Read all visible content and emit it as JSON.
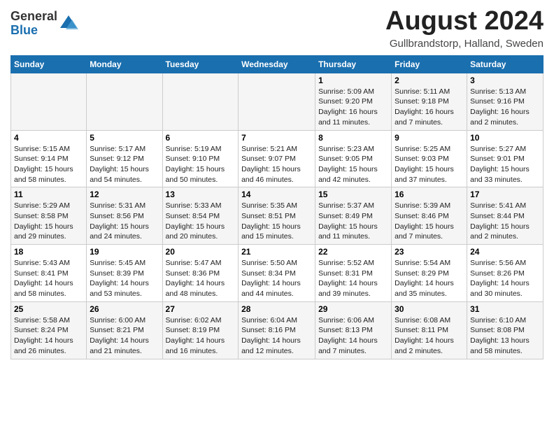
{
  "header": {
    "logo_general": "General",
    "logo_blue": "Blue",
    "month": "August 2024",
    "location": "Gullbrandstorp, Halland, Sweden"
  },
  "days_of_week": [
    "Sunday",
    "Monday",
    "Tuesday",
    "Wednesday",
    "Thursday",
    "Friday",
    "Saturday"
  ],
  "weeks": [
    [
      {
        "day": "",
        "info": ""
      },
      {
        "day": "",
        "info": ""
      },
      {
        "day": "",
        "info": ""
      },
      {
        "day": "",
        "info": ""
      },
      {
        "day": "1",
        "info": "Sunrise: 5:09 AM\nSunset: 9:20 PM\nDaylight: 16 hours\nand 11 minutes."
      },
      {
        "day": "2",
        "info": "Sunrise: 5:11 AM\nSunset: 9:18 PM\nDaylight: 16 hours\nand 7 minutes."
      },
      {
        "day": "3",
        "info": "Sunrise: 5:13 AM\nSunset: 9:16 PM\nDaylight: 16 hours\nand 2 minutes."
      }
    ],
    [
      {
        "day": "4",
        "info": "Sunrise: 5:15 AM\nSunset: 9:14 PM\nDaylight: 15 hours\nand 58 minutes."
      },
      {
        "day": "5",
        "info": "Sunrise: 5:17 AM\nSunset: 9:12 PM\nDaylight: 15 hours\nand 54 minutes."
      },
      {
        "day": "6",
        "info": "Sunrise: 5:19 AM\nSunset: 9:10 PM\nDaylight: 15 hours\nand 50 minutes."
      },
      {
        "day": "7",
        "info": "Sunrise: 5:21 AM\nSunset: 9:07 PM\nDaylight: 15 hours\nand 46 minutes."
      },
      {
        "day": "8",
        "info": "Sunrise: 5:23 AM\nSunset: 9:05 PM\nDaylight: 15 hours\nand 42 minutes."
      },
      {
        "day": "9",
        "info": "Sunrise: 5:25 AM\nSunset: 9:03 PM\nDaylight: 15 hours\nand 37 minutes."
      },
      {
        "day": "10",
        "info": "Sunrise: 5:27 AM\nSunset: 9:01 PM\nDaylight: 15 hours\nand 33 minutes."
      }
    ],
    [
      {
        "day": "11",
        "info": "Sunrise: 5:29 AM\nSunset: 8:58 PM\nDaylight: 15 hours\nand 29 minutes."
      },
      {
        "day": "12",
        "info": "Sunrise: 5:31 AM\nSunset: 8:56 PM\nDaylight: 15 hours\nand 24 minutes."
      },
      {
        "day": "13",
        "info": "Sunrise: 5:33 AM\nSunset: 8:54 PM\nDaylight: 15 hours\nand 20 minutes."
      },
      {
        "day": "14",
        "info": "Sunrise: 5:35 AM\nSunset: 8:51 PM\nDaylight: 15 hours\nand 15 minutes."
      },
      {
        "day": "15",
        "info": "Sunrise: 5:37 AM\nSunset: 8:49 PM\nDaylight: 15 hours\nand 11 minutes."
      },
      {
        "day": "16",
        "info": "Sunrise: 5:39 AM\nSunset: 8:46 PM\nDaylight: 15 hours\nand 7 minutes."
      },
      {
        "day": "17",
        "info": "Sunrise: 5:41 AM\nSunset: 8:44 PM\nDaylight: 15 hours\nand 2 minutes."
      }
    ],
    [
      {
        "day": "18",
        "info": "Sunrise: 5:43 AM\nSunset: 8:41 PM\nDaylight: 14 hours\nand 58 minutes."
      },
      {
        "day": "19",
        "info": "Sunrise: 5:45 AM\nSunset: 8:39 PM\nDaylight: 14 hours\nand 53 minutes."
      },
      {
        "day": "20",
        "info": "Sunrise: 5:47 AM\nSunset: 8:36 PM\nDaylight: 14 hours\nand 48 minutes."
      },
      {
        "day": "21",
        "info": "Sunrise: 5:50 AM\nSunset: 8:34 PM\nDaylight: 14 hours\nand 44 minutes."
      },
      {
        "day": "22",
        "info": "Sunrise: 5:52 AM\nSunset: 8:31 PM\nDaylight: 14 hours\nand 39 minutes."
      },
      {
        "day": "23",
        "info": "Sunrise: 5:54 AM\nSunset: 8:29 PM\nDaylight: 14 hours\nand 35 minutes."
      },
      {
        "day": "24",
        "info": "Sunrise: 5:56 AM\nSunset: 8:26 PM\nDaylight: 14 hours\nand 30 minutes."
      }
    ],
    [
      {
        "day": "25",
        "info": "Sunrise: 5:58 AM\nSunset: 8:24 PM\nDaylight: 14 hours\nand 26 minutes."
      },
      {
        "day": "26",
        "info": "Sunrise: 6:00 AM\nSunset: 8:21 PM\nDaylight: 14 hours\nand 21 minutes."
      },
      {
        "day": "27",
        "info": "Sunrise: 6:02 AM\nSunset: 8:19 PM\nDaylight: 14 hours\nand 16 minutes."
      },
      {
        "day": "28",
        "info": "Sunrise: 6:04 AM\nSunset: 8:16 PM\nDaylight: 14 hours\nand 12 minutes."
      },
      {
        "day": "29",
        "info": "Sunrise: 6:06 AM\nSunset: 8:13 PM\nDaylight: 14 hours\nand 7 minutes."
      },
      {
        "day": "30",
        "info": "Sunrise: 6:08 AM\nSunset: 8:11 PM\nDaylight: 14 hours\nand 2 minutes."
      },
      {
        "day": "31",
        "info": "Sunrise: 6:10 AM\nSunset: 8:08 PM\nDaylight: 13 hours\nand 58 minutes."
      }
    ]
  ]
}
